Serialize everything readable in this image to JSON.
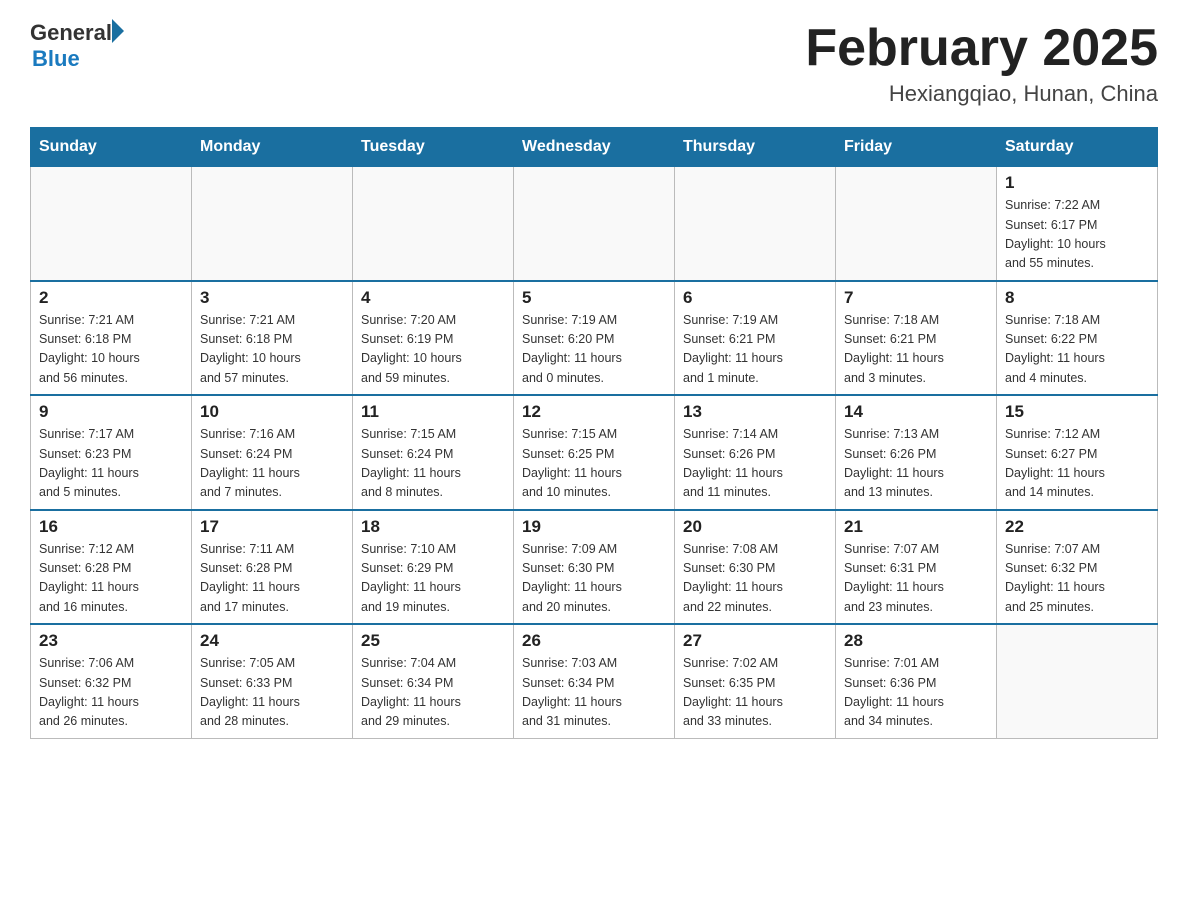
{
  "header": {
    "logo": {
      "general": "General",
      "blue": "Blue"
    },
    "title": "February 2025",
    "location": "Hexiangqiao, Hunan, China"
  },
  "weekdays": [
    "Sunday",
    "Monday",
    "Tuesday",
    "Wednesday",
    "Thursday",
    "Friday",
    "Saturday"
  ],
  "weeks": [
    [
      {
        "day": "",
        "info": ""
      },
      {
        "day": "",
        "info": ""
      },
      {
        "day": "",
        "info": ""
      },
      {
        "day": "",
        "info": ""
      },
      {
        "day": "",
        "info": ""
      },
      {
        "day": "",
        "info": ""
      },
      {
        "day": "1",
        "info": "Sunrise: 7:22 AM\nSunset: 6:17 PM\nDaylight: 10 hours\nand 55 minutes."
      }
    ],
    [
      {
        "day": "2",
        "info": "Sunrise: 7:21 AM\nSunset: 6:18 PM\nDaylight: 10 hours\nand 56 minutes."
      },
      {
        "day": "3",
        "info": "Sunrise: 7:21 AM\nSunset: 6:18 PM\nDaylight: 10 hours\nand 57 minutes."
      },
      {
        "day": "4",
        "info": "Sunrise: 7:20 AM\nSunset: 6:19 PM\nDaylight: 10 hours\nand 59 minutes."
      },
      {
        "day": "5",
        "info": "Sunrise: 7:19 AM\nSunset: 6:20 PM\nDaylight: 11 hours\nand 0 minutes."
      },
      {
        "day": "6",
        "info": "Sunrise: 7:19 AM\nSunset: 6:21 PM\nDaylight: 11 hours\nand 1 minute."
      },
      {
        "day": "7",
        "info": "Sunrise: 7:18 AM\nSunset: 6:21 PM\nDaylight: 11 hours\nand 3 minutes."
      },
      {
        "day": "8",
        "info": "Sunrise: 7:18 AM\nSunset: 6:22 PM\nDaylight: 11 hours\nand 4 minutes."
      }
    ],
    [
      {
        "day": "9",
        "info": "Sunrise: 7:17 AM\nSunset: 6:23 PM\nDaylight: 11 hours\nand 5 minutes."
      },
      {
        "day": "10",
        "info": "Sunrise: 7:16 AM\nSunset: 6:24 PM\nDaylight: 11 hours\nand 7 minutes."
      },
      {
        "day": "11",
        "info": "Sunrise: 7:15 AM\nSunset: 6:24 PM\nDaylight: 11 hours\nand 8 minutes."
      },
      {
        "day": "12",
        "info": "Sunrise: 7:15 AM\nSunset: 6:25 PM\nDaylight: 11 hours\nand 10 minutes."
      },
      {
        "day": "13",
        "info": "Sunrise: 7:14 AM\nSunset: 6:26 PM\nDaylight: 11 hours\nand 11 minutes."
      },
      {
        "day": "14",
        "info": "Sunrise: 7:13 AM\nSunset: 6:26 PM\nDaylight: 11 hours\nand 13 minutes."
      },
      {
        "day": "15",
        "info": "Sunrise: 7:12 AM\nSunset: 6:27 PM\nDaylight: 11 hours\nand 14 minutes."
      }
    ],
    [
      {
        "day": "16",
        "info": "Sunrise: 7:12 AM\nSunset: 6:28 PM\nDaylight: 11 hours\nand 16 minutes."
      },
      {
        "day": "17",
        "info": "Sunrise: 7:11 AM\nSunset: 6:28 PM\nDaylight: 11 hours\nand 17 minutes."
      },
      {
        "day": "18",
        "info": "Sunrise: 7:10 AM\nSunset: 6:29 PM\nDaylight: 11 hours\nand 19 minutes."
      },
      {
        "day": "19",
        "info": "Sunrise: 7:09 AM\nSunset: 6:30 PM\nDaylight: 11 hours\nand 20 minutes."
      },
      {
        "day": "20",
        "info": "Sunrise: 7:08 AM\nSunset: 6:30 PM\nDaylight: 11 hours\nand 22 minutes."
      },
      {
        "day": "21",
        "info": "Sunrise: 7:07 AM\nSunset: 6:31 PM\nDaylight: 11 hours\nand 23 minutes."
      },
      {
        "day": "22",
        "info": "Sunrise: 7:07 AM\nSunset: 6:32 PM\nDaylight: 11 hours\nand 25 minutes."
      }
    ],
    [
      {
        "day": "23",
        "info": "Sunrise: 7:06 AM\nSunset: 6:32 PM\nDaylight: 11 hours\nand 26 minutes."
      },
      {
        "day": "24",
        "info": "Sunrise: 7:05 AM\nSunset: 6:33 PM\nDaylight: 11 hours\nand 28 minutes."
      },
      {
        "day": "25",
        "info": "Sunrise: 7:04 AM\nSunset: 6:34 PM\nDaylight: 11 hours\nand 29 minutes."
      },
      {
        "day": "26",
        "info": "Sunrise: 7:03 AM\nSunset: 6:34 PM\nDaylight: 11 hours\nand 31 minutes."
      },
      {
        "day": "27",
        "info": "Sunrise: 7:02 AM\nSunset: 6:35 PM\nDaylight: 11 hours\nand 33 minutes."
      },
      {
        "day": "28",
        "info": "Sunrise: 7:01 AM\nSunset: 6:36 PM\nDaylight: 11 hours\nand 34 minutes."
      },
      {
        "day": "",
        "info": ""
      }
    ]
  ]
}
